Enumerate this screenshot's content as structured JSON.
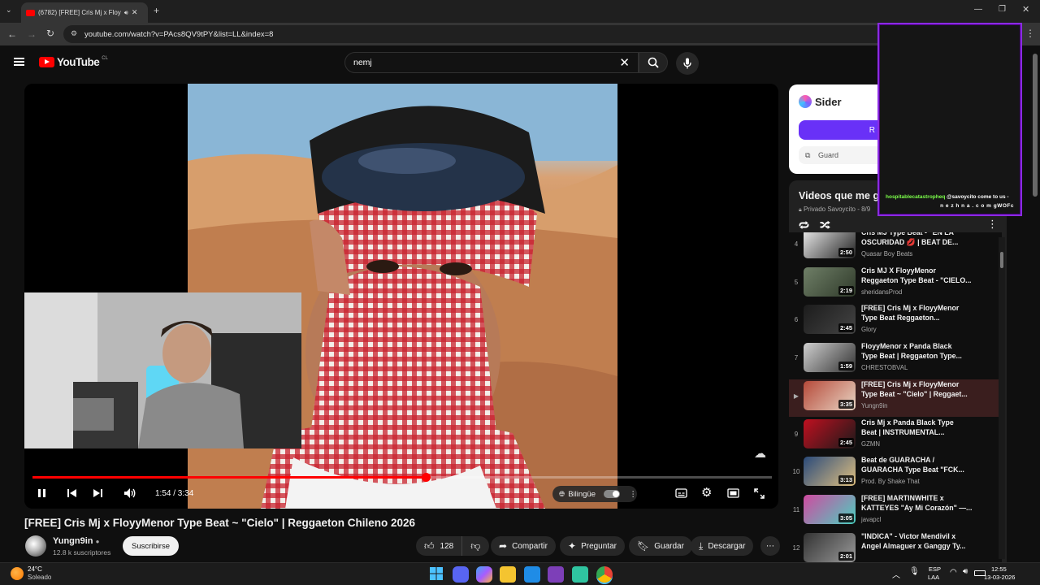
{
  "browser": {
    "tab_title": "(6782) [FREE] Cris Mj x Floy",
    "url": "youtube.com/watch?v=PAcs8QV9tPY&list=LL&index=8"
  },
  "youtube": {
    "logo_text": "YouTube",
    "country_code": "CL",
    "search_value": "nemj"
  },
  "player": {
    "time": "1:54 / 3:34",
    "progress": 0.532,
    "bilingual_label": "Bilingüe",
    "accent_color": "#ff0000"
  },
  "video": {
    "title": "[FREE] Cris Mj x FloyyMenor Type Beat ~ \"Cielo\" | Reggaeton Chileno 2026",
    "channel": "Yungn9in",
    "subscribers": "12.8 k suscriptores",
    "subscribe_label": "Suscribirse",
    "likes": "128",
    "share_label": "Compartir",
    "ask_label": "Preguntar",
    "save_label": "Guardar",
    "download_label": "Descargar"
  },
  "sider": {
    "title": "Sider",
    "button_label": "R",
    "save_label": "Guard"
  },
  "overlay": {
    "user": "hospitablecatastropheq",
    "message": "@savoycito come to us -",
    "site": "n e z h n a . c o m gWOFc"
  },
  "playlist": {
    "title": "Videos que me gu",
    "subtitle": "Privado Savoycito - 8/9",
    "items": [
      {
        "index": "4",
        "line1": "Cris MJ Type Beat - \"EN LA",
        "line2": "OSCURIDAD 💋 | BEAT DE...",
        "channel": "Quasar Boy Beats",
        "duration": "2:50"
      },
      {
        "index": "5",
        "line1": "Cris MJ X FloyyMenor",
        "line2": "Reggaeton Type Beat - \"CIELO...",
        "channel": "sheridansProd",
        "duration": "2:19"
      },
      {
        "index": "6",
        "line1": "[FREE] Cris Mj x FloyyMenor",
        "line2": "Type Beat Reggaeton...",
        "channel": "Glory",
        "duration": "2:45"
      },
      {
        "index": "7",
        "line1": "FloyyMenor x Panda Black",
        "line2": "Type Beat | Reggaeton Type...",
        "channel": "CHRESTOBVAL",
        "duration": "1:59"
      },
      {
        "index": "▶",
        "line1": "[FREE] Cris Mj x FloyyMenor",
        "line2": "Type Beat ~ \"Cielo\" | Reggaet...",
        "channel": "Yungn9in",
        "duration": "3:35"
      },
      {
        "index": "9",
        "line1": "Cris Mj x Panda Black Type",
        "line2": "Beat | INSTRUMENTAL...",
        "channel": "GZMN",
        "duration": "2:45"
      },
      {
        "index": "10",
        "line1": "Beat de GUARACHA /",
        "line2": "GUARACHA Type Beat \"FCK...",
        "channel": "Prod. By Shake That",
        "duration": "3:13"
      },
      {
        "index": "11",
        "line1": "[FREE] MARTINWHITE x",
        "line2": "KATTEYES \"Ay Mi Corazón\" —...",
        "channel": "javapcl",
        "duration": "3:05"
      },
      {
        "index": "12",
        "line1": "\"INDICA\" - Victor Mendivil x",
        "line2": "Angel Almaguer x Ganggy Ty...",
        "channel": "",
        "duration": "2:01"
      }
    ]
  },
  "taskbar": {
    "temperature": "24°C",
    "condition": "Soleado",
    "lang1": "ESP",
    "lang2": "LAA",
    "time": "12:55",
    "date": "13-03-2026"
  }
}
